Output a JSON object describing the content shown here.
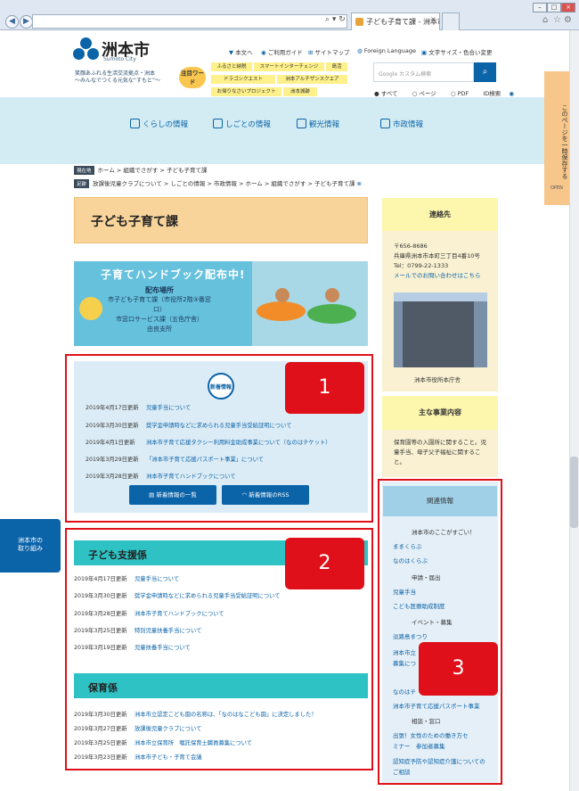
{
  "browser": {
    "address": "",
    "tab_title": "子ども子育て課 - 洲本市..."
  },
  "header": {
    "logo_title": "洲本市",
    "logo_sub": "Sumoto City",
    "tagline1": "笑顔あふれる生活交流拠点・洲本",
    "tagline2": "～みんなでつくる元気な“すもと”～",
    "top_links": [
      "本文へ",
      "ご利用ガイド",
      "サイトマップ",
      "Foreign Language",
      "文字サイズ・色合い変更"
    ],
    "keyword_badge": "注目ワード",
    "keywords_row1": [
      "ふるさと納税",
      "スマートインターチェンジ",
      "島活"
    ],
    "keywords_row2": [
      "ドラゴンクエスト",
      "洲本アルチザンスクエア"
    ],
    "keywords_row3": [
      "お帰りなさいプロジェクト",
      "洲本城跡"
    ],
    "search_placeholder": "Google カスタム検索",
    "search_options": [
      "すべて",
      "ページ",
      "PDF",
      "ID検索"
    ]
  },
  "nav": [
    "くらしの情報",
    "しごとの情報",
    "観光情報",
    "市政情報"
  ],
  "breadcrumb": {
    "current_label": "現在地",
    "current": "ホーム > 組織でさがす > 子ども子育て課",
    "history_label": "足跡",
    "history": "放課後児童クラブについて > しごとの情報 > 市政情報 > ホーム > 組織でさがす > 子ども子育て課"
  },
  "page_title": "子ども子育て課",
  "banner": {
    "title": "子育てハンドブック配布中!",
    "line1": "配布場所",
    "line2": "市子ども子育て課（市役所2階③番窓口）",
    "line3": "市窓口サービス課（五色庁舎）",
    "line4": "由良支所"
  },
  "news": {
    "badge": "新着情報",
    "items": [
      {
        "date": "2019年4月17日更新",
        "title": "児童手当について"
      },
      {
        "date": "2019年3月30日更新",
        "title": "奨学金申請時などに求められる児童手当受給証明について"
      },
      {
        "date": "2019年4月1日更新",
        "title": "洲本市子育て応援タクシー利用料金助成事業について（なのはチケット）"
      },
      {
        "date": "2019年3月29日更新",
        "title": "「洲本市子育て応援パスポート事業」について"
      },
      {
        "date": "2019年3月28日更新",
        "title": "洲本市子育てハンドブックについて"
      }
    ],
    "btn_list": "新着情報の一覧",
    "btn_rss": "新着情報のRSS"
  },
  "section1": {
    "title": "子ども支援係",
    "items": [
      {
        "date": "2019年4月17日更新",
        "title": "児童手当について"
      },
      {
        "date": "2019年3月30日更新",
        "title": "奨学金申請時などに求められる児童手当受給証明について"
      },
      {
        "date": "2019年3月28日更新",
        "title": "洲本市子育てハンドブックについて"
      },
      {
        "date": "2019年3月25日更新",
        "title": "特別児童扶養手当について"
      },
      {
        "date": "2019年3月19日更新",
        "title": "児童扶養手当について"
      }
    ]
  },
  "section2": {
    "title": "保育係",
    "items": [
      {
        "date": "2019年3月30日更新",
        "title": "洲本市立認定こども園の名称は、「なのはなこども園」に決定しました！"
      },
      {
        "date": "2019年3月27日更新",
        "title": "放課後児童クラブについて"
      },
      {
        "date": "2019年3月25日更新",
        "title": "洲本市立保育所　嘱託保育士職員募集について"
      },
      {
        "date": "2019年3月23日更新",
        "title": "洲本市子ども・子育て会議"
      }
    ]
  },
  "sidebar": {
    "contact_title": "連絡先",
    "postal": "〒656-8686",
    "address": "兵庫県洲本市本町三丁目4番10号",
    "tel": "Tel：0799-22-1333",
    "mail_link": "メールでのお問い合わせはこちら",
    "photo_caption": "洲本市役所本庁舎",
    "duties_title": "主な事業内容",
    "duties": "保育園等の入園所に関すること。児童手当、母子父子福祉に関すること。",
    "related_title": "関連情報",
    "related": [
      {
        "kind": "cat",
        "text": "洲本市のここがすごい！"
      },
      {
        "kind": "link",
        "text": "ままくらぶ"
      },
      {
        "kind": "link",
        "text": "なのはくらぶ"
      },
      {
        "kind": "cat",
        "text": "申請・届出"
      },
      {
        "kind": "link",
        "text": "児童手当"
      },
      {
        "kind": "link",
        "text": "こども医療助成制度"
      },
      {
        "kind": "cat",
        "text": "イベント・募集"
      },
      {
        "kind": "link",
        "text": "淡路島まつり"
      },
      {
        "kind": "link",
        "text": "洲本市立"
      },
      {
        "kind": "link",
        "text": "募集につ"
      },
      {
        "kind": "link",
        "text": "なのはチ"
      },
      {
        "kind": "link",
        "text": "洲本市子育て応援パスポート事業"
      },
      {
        "kind": "cat",
        "text": "相談・窓口"
      },
      {
        "kind": "link",
        "text": "出張！女性のための働き方セ"
      },
      {
        "kind": "link",
        "text": "ミナー　参加者募集"
      },
      {
        "kind": "link",
        "text": "認知症予防や認知症介護についての"
      },
      {
        "kind": "link",
        "text": "ご相談"
      }
    ]
  },
  "rail": "このページを一時保存する",
  "rail_sub": "OPEN",
  "left_stub": [
    "洲本市の",
    "取り組み"
  ],
  "annotations": [
    "1",
    "2",
    "3"
  ]
}
